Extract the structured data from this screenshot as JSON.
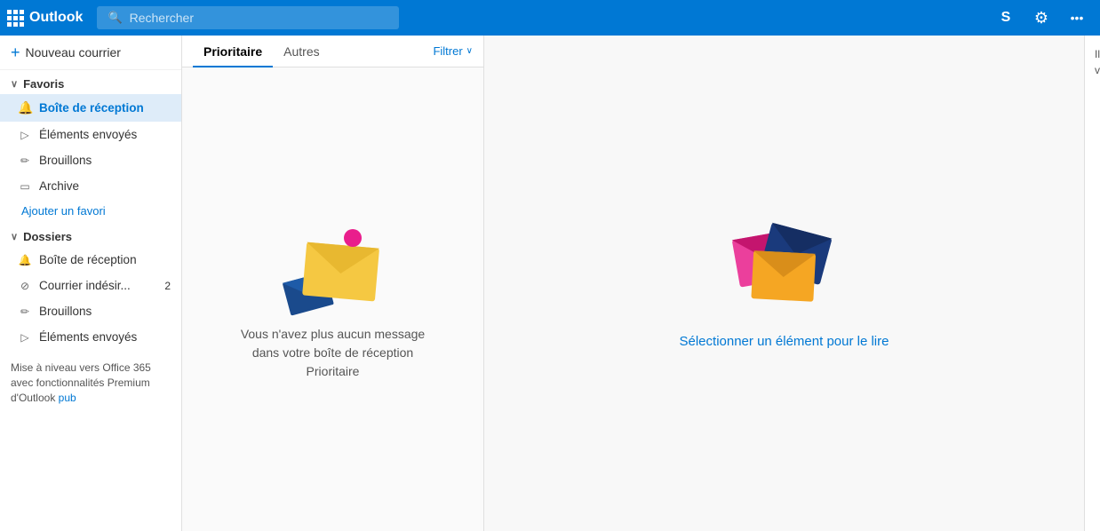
{
  "topbar": {
    "logo": "Outlook",
    "search_placeholder": "Rechercher",
    "skype_icon": "S",
    "settings_icon": "⚙",
    "menu_icon": "☰"
  },
  "sidebar": {
    "new_mail_label": "Nouveau courrier",
    "favorites_section": "Favoris",
    "folders_section": "Dossiers",
    "items_favorites": [
      {
        "id": "inbox-fav",
        "label": "Boîte de réception",
        "icon": "🔔",
        "active": true
      },
      {
        "id": "sent-fav",
        "label": "Éléments envoyés",
        "icon": "▷"
      },
      {
        "id": "drafts-fav",
        "label": "Brouillons",
        "icon": "✏"
      },
      {
        "id": "archive-fav",
        "label": "Archive",
        "icon": "▭"
      }
    ],
    "add_favorite_label": "Ajouter un favori",
    "items_folders": [
      {
        "id": "inbox-folder",
        "label": "Boîte de réception",
        "icon": "🔔"
      },
      {
        "id": "junk-folder",
        "label": "Courrier indésir...",
        "icon": "⊘",
        "badge": "2"
      },
      {
        "id": "drafts-folder",
        "label": "Brouillons",
        "icon": "✏"
      },
      {
        "id": "sent-folder",
        "label": "Éléments envoyés",
        "icon": "▷"
      }
    ],
    "upgrade": {
      "text": "Mise à niveau vers Office 365 avec fonctionnalités Premium d'Outlook",
      "link": "pub"
    }
  },
  "email_list": {
    "tab_priority": "Prioritaire",
    "tab_others": "Autres",
    "filter_label": "Filtrer",
    "empty_text": "Vous n'avez plus aucun message dans votre boîte de réception Prioritaire"
  },
  "reading_pane": {
    "select_text_part1": "Sélectionner",
    "select_text_part2": "un élément pour le lire"
  },
  "right_panel": {
    "text": "Il se utilise de p opt dans récept vous pub"
  }
}
